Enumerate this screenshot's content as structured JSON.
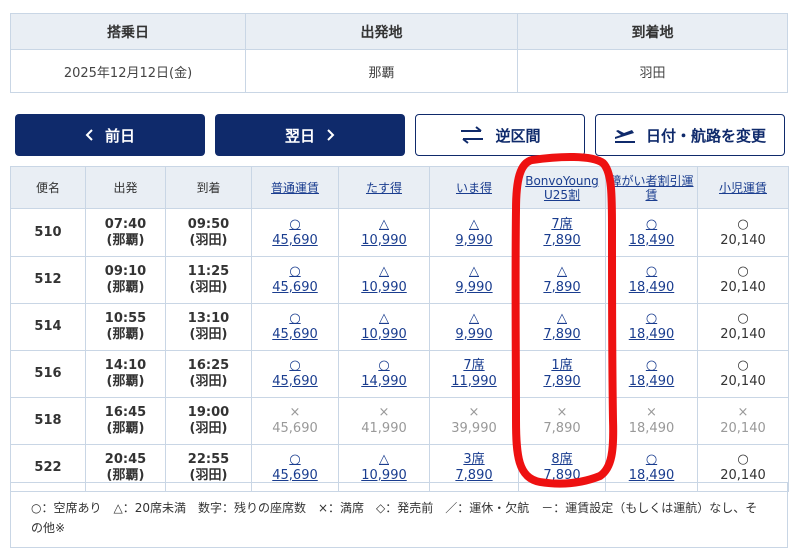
{
  "summary": {
    "headers": [
      "搭乗日",
      "出発地",
      "到着地"
    ],
    "values": [
      "2025年12月12日(金)",
      "那覇",
      "羽田"
    ]
  },
  "buttons": {
    "prev_day": "前日",
    "next_day": "翌日",
    "reverse": "逆区間",
    "change": "日付・航路を変更"
  },
  "table": {
    "headers": {
      "flight": "便名",
      "depart": "出発",
      "arrive": "到着",
      "fare1": "普通運賃",
      "fare2": "たす得",
      "fare3": "いま得",
      "fare4_line1": "BonvoYoung",
      "fare4_line2": "U25割",
      "fare5": "障がい者割引運賃",
      "fare6": "小児運賃"
    },
    "rows": [
      {
        "flight": "510",
        "dep_time": "07:40",
        "dep_place": "(那覇)",
        "arr_time": "09:50",
        "arr_place": "(羽田)",
        "f1_status": "○",
        "f1_price": "45,690",
        "f2_status": "△",
        "f2_price": "10,990",
        "f3_status": "△",
        "f3_price": "9,990",
        "f4_status": "7席",
        "f4_price": "7,890",
        "f5_status": "○",
        "f5_price": "18,490",
        "f6_status": "○",
        "f6_price": "20,140"
      },
      {
        "flight": "512",
        "dep_time": "09:10",
        "dep_place": "(那覇)",
        "arr_time": "11:25",
        "arr_place": "(羽田)",
        "f1_status": "○",
        "f1_price": "45,690",
        "f2_status": "△",
        "f2_price": "10,990",
        "f3_status": "△",
        "f3_price": "9,990",
        "f4_status": "△",
        "f4_price": "7,890",
        "f5_status": "○",
        "f5_price": "18,490",
        "f6_status": "○",
        "f6_price": "20,140"
      },
      {
        "flight": "514",
        "dep_time": "10:55",
        "dep_place": "(那覇)",
        "arr_time": "13:10",
        "arr_place": "(羽田)",
        "f1_status": "○",
        "f1_price": "45,690",
        "f2_status": "△",
        "f2_price": "10,990",
        "f3_status": "△",
        "f3_price": "9,990",
        "f4_status": "△",
        "f4_price": "7,890",
        "f5_status": "○",
        "f5_price": "18,490",
        "f6_status": "○",
        "f6_price": "20,140"
      },
      {
        "flight": "516",
        "dep_time": "14:10",
        "dep_place": "(那覇)",
        "arr_time": "16:25",
        "arr_place": "(羽田)",
        "f1_status": "○",
        "f1_price": "45,690",
        "f2_status": "○",
        "f2_price": "14,990",
        "f3_status": "7席",
        "f3_price": "11,990",
        "f4_status": "1席",
        "f4_price": "7,890",
        "f5_status": "○",
        "f5_price": "18,490",
        "f6_status": "○",
        "f6_price": "20,140"
      },
      {
        "flight": "518",
        "dep_time": "16:45",
        "dep_place": "(那覇)",
        "arr_time": "19:00",
        "arr_place": "(羽田)",
        "f1_status": "×",
        "f1_price": "45,690",
        "f2_status": "×",
        "f2_price": "41,990",
        "f3_status": "×",
        "f3_price": "39,990",
        "f4_status": "×",
        "f4_price": "7,890",
        "f5_status": "×",
        "f5_price": "18,490",
        "f6_status": "×",
        "f6_price": "20,140"
      },
      {
        "flight": "522",
        "dep_time": "20:45",
        "dep_place": "(那覇)",
        "arr_time": "22:55",
        "arr_place": "(羽田)",
        "f1_status": "○",
        "f1_price": "45,690",
        "f2_status": "△",
        "f2_price": "10,990",
        "f3_status": "3席",
        "f3_price": "7,890",
        "f4_status": "8席",
        "f4_price": "7,890",
        "f5_status": "○",
        "f5_price": "18,490",
        "f6_status": "○",
        "f6_price": "20,140"
      }
    ]
  },
  "legend": {
    "text": "○：空席あり　△：20席未満　数字：残りの座席数　×：満席　◇：発売前　／：運休・欠航　－：運賃設定（もしくは運航）なし、その他※"
  },
  "colors": {
    "navy": "#0f2a6b",
    "link": "#1a3d8f",
    "header_bg": "#e9eef4",
    "border": "#c9d6e5",
    "annotation": "#ee1111"
  }
}
